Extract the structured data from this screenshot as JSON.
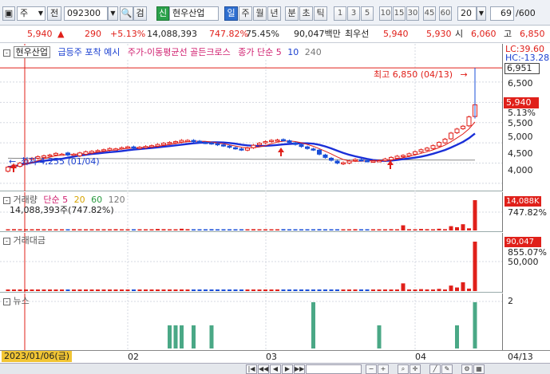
{
  "toolbar": {
    "market_type": "주",
    "prev_label": "전",
    "code": "092300",
    "search_label": "검",
    "new_badge": "신",
    "stock_name": "현우산업",
    "period_tabs": [
      "일",
      "주",
      "월",
      "년",
      "분",
      "초",
      "틱"
    ],
    "active_period": "일",
    "intervals": [
      "1",
      "3",
      "5",
      "10",
      "15",
      "30",
      "45",
      "60"
    ],
    "interval_value": "20",
    "count_value": "69",
    "count_total": "/600"
  },
  "quote": {
    "price": "5,940",
    "arrow": "▲",
    "change": "290",
    "change_pct": "+5.13%",
    "volume": "14,088,393",
    "volume_ratio": "747.82%",
    "turnover": "75.45%",
    "amount": "90,047백만",
    "best_bid_label": "최우선",
    "best_ask": "5,940",
    "best_bid": "5,930",
    "open_label": "시",
    "open": "6,060",
    "high_label": "고",
    "high": "6,850"
  },
  "price_panel": {
    "legend_name": "현우산업",
    "legend_signal": "급등주 포착 예시",
    "legend_cross": "주가-이동평균선 골든크로스",
    "legend_ma_label": "종가 단순",
    "ma_periods": [
      "5",
      "10",
      "240"
    ],
    "lc_label": "LC:39.60",
    "hc_label": "HC:-13.28",
    "high_price_box": "6,951",
    "current_price_box": "5,940",
    "current_pct": "5.13%",
    "high_annotation": "최고 6,850 (04/13)",
    "high_arrow": "→",
    "low_annotation": "최저 4,255 (01/04)",
    "low_arrow": "←",
    "y_ticks": [
      "6,500",
      "6,000",
      "5,500",
      "5,000",
      "4,500",
      "4,000"
    ]
  },
  "volume_panel": {
    "legend_name": "거래량",
    "legend_ma": "단순",
    "ma_periods": [
      "5",
      "20",
      "60",
      "120"
    ],
    "value_line": "14,088,393주(747.82%)",
    "box_value": "14,088K",
    "box_pct": "747.82%"
  },
  "amount_panel": {
    "legend_name": "거래대금",
    "box_value": "90,047",
    "box_pct": "855.07%",
    "tick": "50,000"
  },
  "news_panel": {
    "legend_name": "뉴스",
    "tick": "2"
  },
  "dates": {
    "cursor_date": "2023/01/06(금)",
    "months": [
      "02",
      "03",
      "04"
    ],
    "right_date": "04/13"
  },
  "chart_data": {
    "type": "candlestick",
    "x": [
      "01/04",
      "04/13"
    ],
    "series": [
      {
        "open": [
          4300,
          4380,
          4420,
          4500,
          4600,
          4620,
          4640,
          4680,
          4700,
          4720,
          4750,
          4700,
          4680,
          4720,
          4750,
          4790,
          4800,
          4820,
          4850,
          4860,
          4880,
          4900,
          4870,
          4880,
          4900,
          4920,
          4950,
          4980,
          5000,
          5020,
          5050,
          5060,
          5040,
          5010,
          5000,
          4980,
          4950,
          4920,
          4880,
          4850,
          4820,
          4880,
          4950,
          5000,
          5030,
          5060,
          5080,
          5050,
          5000,
          4950,
          4900,
          4850,
          4820,
          4700,
          4620,
          4550,
          4480,
          4500,
          4560,
          4580,
          4560,
          4540,
          4560,
          4560,
          4580,
          4620,
          4660,
          4680,
          4720,
          4780,
          4820,
          4860,
          4920,
          5000,
          5100,
          5250,
          5350,
          5420,
          5650
        ],
        "close": [
          4400,
          4450,
          4500,
          4580,
          4620,
          4660,
          4680,
          4700,
          4740,
          4720,
          4700,
          4720,
          4750,
          4780,
          4790,
          4810,
          4830,
          4860,
          4850,
          4880,
          4900,
          4880,
          4890,
          4910,
          4930,
          4960,
          4990,
          5010,
          5030,
          5060,
          5060,
          5040,
          5020,
          5000,
          4980,
          4950,
          4930,
          4890,
          4860,
          4830,
          4870,
          4940,
          4990,
          5030,
          5060,
          5070,
          5060,
          5010,
          4960,
          4910,
          4860,
          4830,
          4720,
          4640,
          4570,
          4500,
          4510,
          4550,
          4590,
          4570,
          4550,
          4550,
          4560,
          4600,
          4640,
          4670,
          4690,
          4730,
          4780,
          4830,
          4870,
          4930,
          5010,
          5090,
          5240,
          5340,
          5410,
          5640,
          5940
        ]
      }
    ],
    "high_point": {
      "date": "04/13",
      "price": 6850
    },
    "low_point": {
      "date": "01/04",
      "price": 4255
    },
    "ylim": [
      3900,
      6951
    ],
    "volume": [
      0.5,
      0.6,
      0.5,
      0.4,
      0.5,
      0.6,
      0.5,
      0.5,
      0.4,
      0.4,
      0.5,
      0.6,
      0.5,
      0.4,
      0.5,
      0.5,
      0.4,
      0.4,
      0.6,
      0.5,
      0.4,
      0.5,
      0.5,
      0.4,
      0.5,
      0.7,
      0.6,
      0.5,
      0.5,
      0.8,
      0.6,
      0.5,
      0.4,
      0.5,
      0.6,
      0.5,
      0.5,
      0.4,
      0.4,
      0.5,
      0.5,
      0.6,
      0.5,
      0.4,
      0.5,
      0.5,
      0.6,
      0.5,
      0.4,
      0.4,
      0.5,
      0.5,
      0.6,
      0.5,
      0.5,
      0.4,
      0.4,
      0.5,
      0.6,
      0.4,
      0.5,
      0.5,
      0.4,
      0.5,
      0.6,
      0.5,
      2.4,
      0.6,
      0.5,
      0.7,
      0.6,
      0.5,
      0.8,
      0.6,
      2.0,
      1.5,
      2.9,
      1.0,
      14.088
    ],
    "amount": [
      1.8,
      2.0,
      1.6,
      1.5,
      1.7,
      2.2,
      1.8,
      1.6,
      1.4,
      1.5,
      1.9,
      2.1,
      1.7,
      1.5,
      1.8,
      1.6,
      1.5,
      1.4,
      2.0,
      1.8,
      1.4,
      1.6,
      1.7,
      1.5,
      1.8,
      2.4,
      2.0,
      1.8,
      1.7,
      2.8,
      2.1,
      1.7,
      1.5,
      1.8,
      2.0,
      1.8,
      1.7,
      1.5,
      1.4,
      1.6,
      1.7,
      2.1,
      1.8,
      1.5,
      1.6,
      1.7,
      2.0,
      1.8,
      1.4,
      1.5,
      1.7,
      1.6,
      2.0,
      1.7,
      1.6,
      1.4,
      1.3,
      1.6,
      2.0,
      1.4,
      1.7,
      1.6,
      1.3,
      1.7,
      2.0,
      1.8,
      14.0,
      3.0,
      2.5,
      3.5,
      3.0,
      2.4,
      4.0,
      2.8,
      10.0,
      6.5,
      16.0,
      4.5,
      90.047
    ],
    "news": [
      0,
      0,
      0,
      0,
      0,
      0,
      0,
      0,
      0,
      0,
      0,
      0,
      0,
      0,
      0,
      0,
      0,
      0,
      0,
      0,
      0,
      0,
      0,
      0,
      0,
      0,
      0,
      1,
      1,
      1,
      0,
      1,
      0,
      0,
      1,
      0,
      0,
      0,
      0,
      0,
      0,
      0,
      0,
      0,
      0,
      0,
      0,
      0,
      0,
      0,
      0,
      2,
      0,
      0,
      0,
      0,
      0,
      0,
      0,
      0,
      0,
      0,
      1,
      0,
      0,
      0,
      0,
      0,
      0,
      0,
      0,
      0,
      0,
      0,
      0,
      1,
      0,
      0,
      2
    ]
  }
}
